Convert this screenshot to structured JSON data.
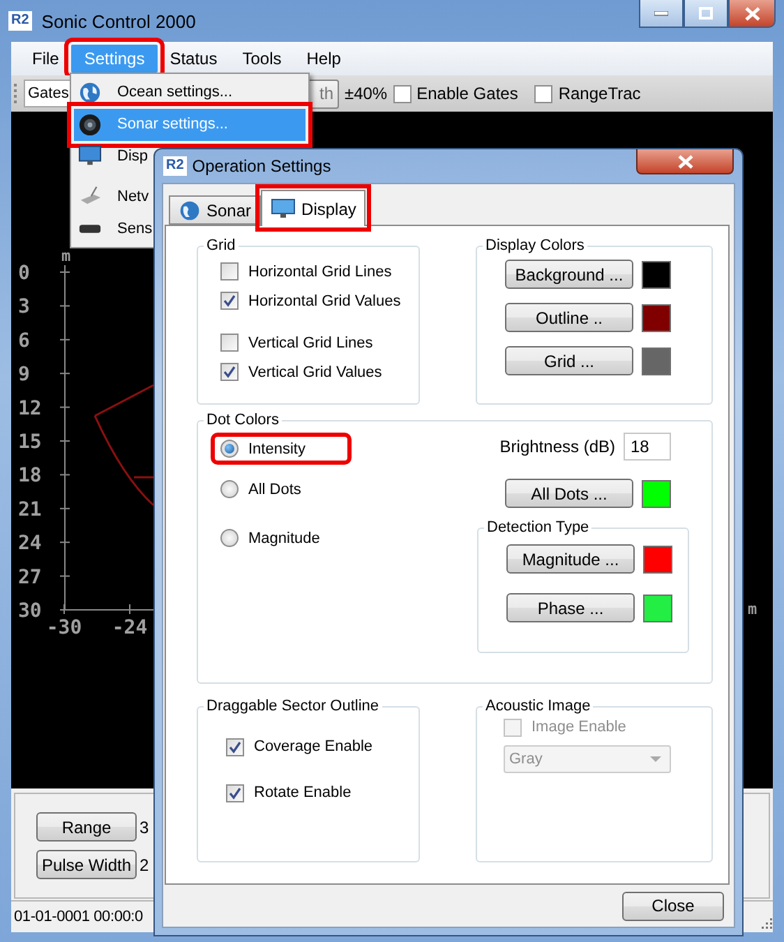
{
  "window": {
    "logo": "R2",
    "title": "Sonic Control 2000"
  },
  "menu_bar": [
    {
      "label": "File",
      "selected": false,
      "callout": false
    },
    {
      "label": "Settings",
      "selected": true,
      "callout": true
    },
    {
      "label": "Status",
      "selected": false,
      "callout": false
    },
    {
      "label": "Tools",
      "selected": false,
      "callout": false
    },
    {
      "label": "Help",
      "selected": false,
      "callout": false
    }
  ],
  "toolbar": {
    "gates_field": "Gates",
    "button": "th",
    "percent": "±40%",
    "checkboxes": [
      {
        "label": "Enable Gates",
        "checked": false
      },
      {
        "label": "RangeTrac",
        "checked": false
      }
    ]
  },
  "plot": {
    "unit_left": "m",
    "unit_right": "m",
    "y_labels": [
      "0",
      "3",
      "6",
      "9",
      "12",
      "15",
      "18",
      "21",
      "24",
      "27",
      "30"
    ],
    "x_labels": [
      "-30",
      "-24"
    ]
  },
  "bottom_panel": [
    {
      "button": "Range",
      "value": "3"
    },
    {
      "button": "Pulse Width",
      "value": "2"
    }
  ],
  "status_bar": "01-01-0001 00:00:0",
  "dropdown_menu": [
    {
      "label": "Ocean settings...",
      "selected": false,
      "callout": false
    },
    {
      "label": "Sonar settings...",
      "selected": true,
      "callout": true
    },
    {
      "label": "Disp",
      "selected": false,
      "callout": false
    },
    {
      "label": "Netv",
      "selected": false,
      "callout": false
    },
    {
      "label": "Sens",
      "selected": false,
      "callout": false
    }
  ],
  "dialog": {
    "logo": "R2",
    "title": "Operation Settings",
    "tabs": [
      {
        "label": "Sonar",
        "selected": false,
        "callout": false
      },
      {
        "label": "Display",
        "selected": true,
        "callout": true
      }
    ],
    "grid_group": {
      "title": "Grid",
      "options": [
        {
          "label": "Horizontal Grid Lines",
          "checked": false
        },
        {
          "label": "Horizontal Grid Values",
          "checked": true
        },
        {
          "label": "Vertical Grid Lines",
          "checked": false
        },
        {
          "label": "Vertical Grid Values",
          "checked": true
        }
      ]
    },
    "display_colors": {
      "title": "Display Colors",
      "items": [
        {
          "button": "Background ...",
          "color": "#000000"
        },
        {
          "button": "Outline ..",
          "color": "#800000"
        },
        {
          "button": "Grid ...",
          "color": "#666666"
        }
      ]
    },
    "dot_colors": {
      "title": "Dot Colors",
      "modes": [
        {
          "label": "Intensity",
          "selected": true,
          "callout": true
        },
        {
          "label": "All Dots",
          "selected": false,
          "callout": false
        },
        {
          "label": "Magnitude",
          "selected": false,
          "callout": false
        }
      ],
      "brightness_label": "Brightness (dB)",
      "brightness_value": "18",
      "all_dots": {
        "button": "All Dots ...",
        "color": "#00ff00"
      },
      "detection_type": {
        "title": "Detection Type",
        "items": [
          {
            "button": "Magnitude ...",
            "color": "#ff0000"
          },
          {
            "button": "Phase ...",
            "color": "#22ee44"
          }
        ]
      }
    },
    "sector_outline": {
      "title": "Draggable Sector Outline",
      "options": [
        {
          "label": "Coverage Enable",
          "checked": true
        },
        {
          "label": "Rotate Enable",
          "checked": true
        }
      ]
    },
    "acoustic_image": {
      "title": "Acoustic Image",
      "image_enable": {
        "label": "Image Enable",
        "checked": false,
        "disabled": true
      },
      "palette": {
        "value": "Gray",
        "disabled": true
      }
    },
    "close_button": "Close"
  }
}
